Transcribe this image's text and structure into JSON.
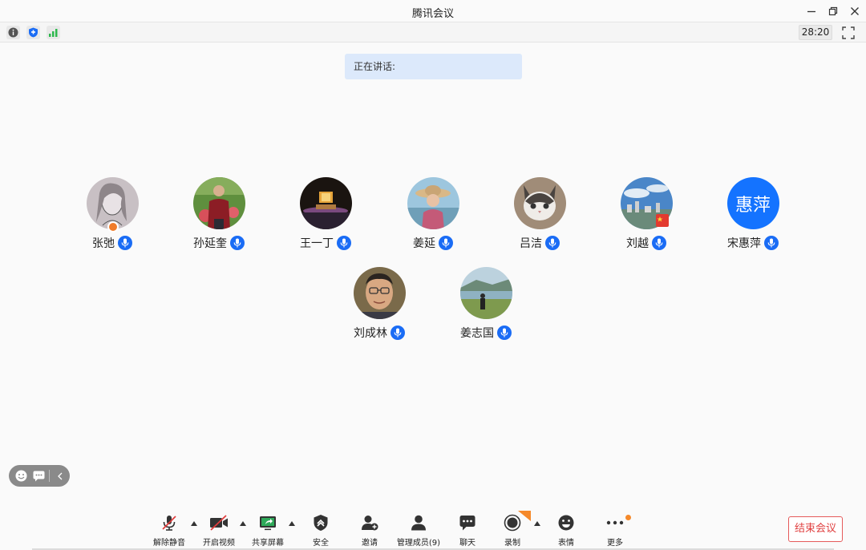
{
  "window": {
    "title": "腾讯会议"
  },
  "infobar": {
    "timer": "28:20"
  },
  "speaking": {
    "label": "正在讲话:"
  },
  "participants": [
    {
      "name": "张弛",
      "avatar": "photo-sketch",
      "host": true
    },
    {
      "name": "孙延奎",
      "avatar": "photo-man-garden"
    },
    {
      "name": "王一丁",
      "avatar": "photo-stage"
    },
    {
      "name": "姜延",
      "avatar": "photo-woman-hat"
    },
    {
      "name": "吕洁",
      "avatar": "photo-cat"
    },
    {
      "name": "刘越",
      "avatar": "photo-city"
    },
    {
      "name": "宋惠萍",
      "avatar": "text",
      "avatar_text": "惠萍"
    },
    {
      "name": "刘成林",
      "avatar": "photo-man-portrait"
    },
    {
      "name": "姜志国",
      "avatar": "photo-lake"
    }
  ],
  "toolbar": {
    "unmute": "解除静音",
    "video": "开启视频",
    "share": "共享屏幕",
    "security": "安全",
    "invite": "邀请",
    "members": "管理成员(9)",
    "chat": "聊天",
    "record": "录制",
    "emoji": "表情",
    "more": "更多",
    "end": "结束会议"
  },
  "colors": {
    "accent": "#1a6cf5",
    "end": "#e04040",
    "speaking_bg": "#dce9fb"
  }
}
